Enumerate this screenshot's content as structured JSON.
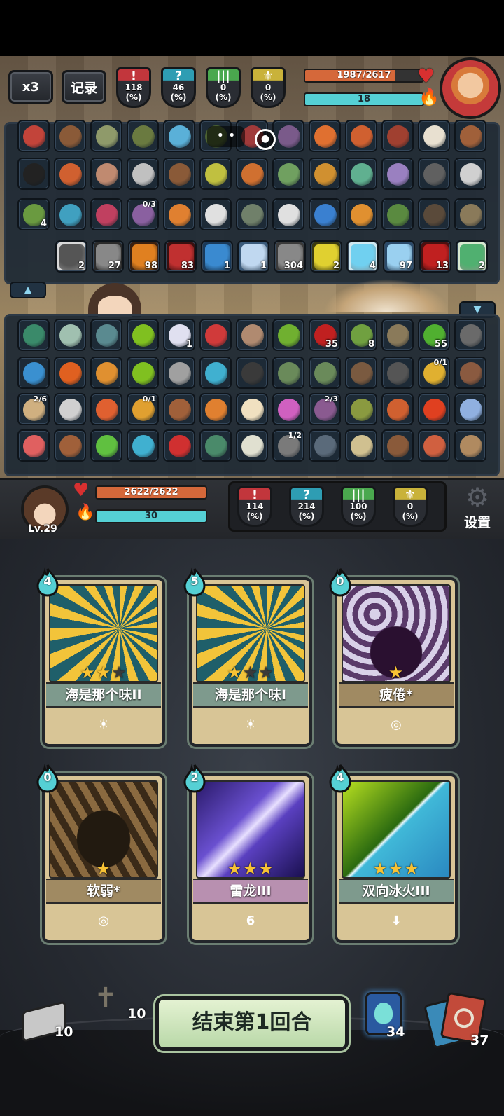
{
  "top": {
    "speed_label": "x3",
    "log_label": "记录",
    "enemy_stats": [
      {
        "value": "118",
        "unit": "(%)",
        "color": "#c2363c",
        "symbol": "!"
      },
      {
        "value": "46",
        "unit": "(%)",
        "color": "#2e9db3",
        "symbol": "?"
      },
      {
        "value": "0",
        "unit": "(%)",
        "color": "#4aa84e",
        "symbol": "|||"
      },
      {
        "value": "0",
        "unit": "(%)",
        "color": "#c9b23a",
        "symbol": "⚜"
      }
    ],
    "enemy_hp": "1987/2617",
    "enemy_hp_fraction": 0.759,
    "enemy_energy": "18",
    "enemy_energy_fraction": 1.0
  },
  "enemy_items": {
    "row1": [
      {
        "c": "#c2443a"
      },
      {
        "c": "#8a5a38"
      },
      {
        "c": "#8f9a6a"
      },
      {
        "c": "#6a7a40"
      },
      {
        "c": "#5ab0d8"
      },
      {
        "c": "#4a6030"
      },
      {
        "c": "#a03a3a"
      },
      {
        "c": "#7a5a8a"
      },
      {
        "c": "#e07030"
      },
      {
        "c": "#d06030"
      },
      {
        "c": "#a04030"
      },
      {
        "c": "#e8e0d0"
      },
      {
        "c": "#a0603a"
      }
    ],
    "row2": [
      {
        "c": "#222"
      },
      {
        "c": "#d06030"
      },
      {
        "c": "#c08a70"
      },
      {
        "c": "#c0c0c0"
      },
      {
        "c": "#8a5a38"
      },
      {
        "c": "#c0c040"
      },
      {
        "c": "#d07030"
      },
      {
        "c": "#70a060"
      },
      {
        "c": "#d09030"
      },
      {
        "c": "#60b090"
      },
      {
        "c": "#9a80c0"
      },
      {
        "c": "#606060"
      },
      {
        "c": "#d0d0d0"
      }
    ],
    "row3": [
      {
        "c": "#6a9a40",
        "num": "4"
      },
      {
        "c": "#40a0c0"
      },
      {
        "c": "#c04060"
      },
      {
        "c": "#8a60a0",
        "frac": "0/3"
      },
      {
        "c": "#e08030"
      },
      {
        "c": "#e0e0e0"
      },
      {
        "c": "#70806a"
      },
      {
        "c": "#e0e0e0"
      },
      {
        "c": "#3a80d0"
      },
      {
        "c": "#e09030"
      },
      {
        "c": "#5a8a40"
      },
      {
        "c": "#5a4a3a"
      },
      {
        "c": "#8a7a5a"
      }
    ],
    "effects": [
      {
        "c": "#555",
        "num": "2",
        "bg": "#d8d8d8"
      },
      {
        "c": "#888",
        "num": "27",
        "bg": "#2a2a2a"
      },
      {
        "c": "#e08020",
        "num": "98",
        "bg": "#3a2010"
      },
      {
        "c": "#c03030",
        "num": "83",
        "bg": "#3a1010"
      },
      {
        "c": "#3a8ad0",
        "num": "1",
        "bg": "#1a3a5a"
      },
      {
        "c": "#c0d8f0",
        "num": "1",
        "bg": "#3a5a7a"
      },
      {
        "c": "#888",
        "num": "304",
        "bg": "#3a3a3a"
      },
      {
        "c": "#e0d030",
        "num": "2",
        "bg": "#3a3a10"
      },
      {
        "c": "#70d0f0",
        "num": "4",
        "bg": "#d0e8f0"
      },
      {
        "c": "#9ad0f0",
        "num": "97",
        "bg": "#2a4a6a"
      },
      {
        "c": "#c02020",
        "num": "13",
        "bg": "#4a1010"
      },
      {
        "c": "#50b070",
        "num": "2",
        "bg": "#d8e8d0"
      }
    ]
  },
  "player_items": {
    "row1": [
      {
        "c": "#3a8a6a"
      },
      {
        "c": "#a0c0b0"
      },
      {
        "c": "#5a8a90"
      },
      {
        "c": "#80c020"
      },
      {
        "c": "#e0e0f0",
        "num": "1"
      },
      {
        "c": "#d03a3a"
      },
      {
        "c": "#b08a70"
      },
      {
        "c": "#70b030"
      },
      {
        "c": "#c02020",
        "num": "35"
      },
      {
        "c": "#70a040",
        "num": "8"
      },
      {
        "c": "#8a7a5a"
      },
      {
        "c": "#50b030",
        "num": "55"
      },
      {
        "c": "#6a6a6a"
      }
    ],
    "row2": [
      {
        "c": "#3a90d0"
      },
      {
        "c": "#e06020"
      },
      {
        "c": "#e09030"
      },
      {
        "c": "#80c020"
      },
      {
        "c": "#a0a0a0"
      },
      {
        "c": "#40b0d0"
      },
      {
        "c": "#3a3a3a"
      },
      {
        "c": "#6a8a5a"
      },
      {
        "c": "#6a8a5a"
      },
      {
        "c": "#7a5a40"
      },
      {
        "c": "#555"
      },
      {
        "c": "#e0b030",
        "frac": "0/1"
      },
      {
        "c": "#8a5a40"
      }
    ],
    "row3": [
      {
        "c": "#d0b080",
        "frac": "2/6"
      },
      {
        "c": "#d0d0d0"
      },
      {
        "c": "#e06030"
      },
      {
        "c": "#e0a030",
        "frac": "0/1"
      },
      {
        "c": "#a0603a"
      },
      {
        "c": "#e08030"
      },
      {
        "c": "#f0e0c0"
      },
      {
        "c": "#d060c0"
      },
      {
        "c": "#8a5a90",
        "frac": "2/3"
      },
      {
        "c": "#8a9a40"
      },
      {
        "c": "#d06030"
      },
      {
        "c": "#e04020"
      },
      {
        "c": "#90b0e0"
      }
    ],
    "row4": [
      {
        "c": "#e06060"
      },
      {
        "c": "#a0603a"
      },
      {
        "c": "#60c040"
      },
      {
        "c": "#40b0d0"
      },
      {
        "c": "#d03030"
      },
      {
        "c": "#4a8a6a"
      },
      {
        "c": "#e0e0d0"
      },
      {
        "c": "#7a7a7a",
        "frac": "1/2"
      },
      {
        "c": "#5a6a7a"
      },
      {
        "c": "#d0c090"
      },
      {
        "c": "#8a5a3a"
      },
      {
        "c": "#d06040"
      },
      {
        "c": "#b08a60"
      }
    ]
  },
  "player": {
    "level": "Lv.29",
    "hp": "2622/2622",
    "hp_fraction": 1.0,
    "energy": "30",
    "energy_fraction": 1.0,
    "stats": [
      {
        "value": "114",
        "unit": "(%)",
        "color": "#c2363c",
        "symbol": "!"
      },
      {
        "value": "214",
        "unit": "(%)",
        "color": "#2e9db3",
        "symbol": "?"
      },
      {
        "value": "100",
        "unit": "(%)",
        "color": "#4aa84e",
        "symbol": "|||"
      },
      {
        "value": "0",
        "unit": "(%)",
        "color": "#c9b23a",
        "symbol": "⚜"
      }
    ],
    "settings_label": "设置"
  },
  "cards": [
    {
      "cost": "4",
      "name": "海是那个味II",
      "stars": 2,
      "max_stars": 3,
      "foot": "☀",
      "art": "sun",
      "band": "#7e9a8d"
    },
    {
      "cost": "5",
      "name": "海是那个味I",
      "stars": 1,
      "max_stars": 3,
      "foot": "☀",
      "art": "sun",
      "band": "#7e9a8d"
    },
    {
      "cost": "0",
      "name": "疲倦*",
      "stars": 1,
      "max_stars": 1,
      "foot": "◎",
      "art": "tired",
      "band": "#a08a62"
    },
    {
      "cost": "0",
      "name": "软弱*",
      "stars": 1,
      "max_stars": 1,
      "foot": "◎",
      "art": "weak",
      "band": "#a08a62"
    },
    {
      "cost": "2",
      "name": "雷龙III",
      "stars": 3,
      "max_stars": 3,
      "foot": "6",
      "art": "dragon",
      "band": "#b890b0"
    },
    {
      "cost": "4",
      "name": "双向冰火III",
      "stars": 3,
      "max_stars": 3,
      "foot": "⬇",
      "art": "icefire",
      "band": "#7e9a8d"
    }
  ],
  "bottom": {
    "draw_pile": "10",
    "grave_pile": "10",
    "end_turn": "结束第1回合",
    "potion_count": "34",
    "discard_pile": "37"
  }
}
